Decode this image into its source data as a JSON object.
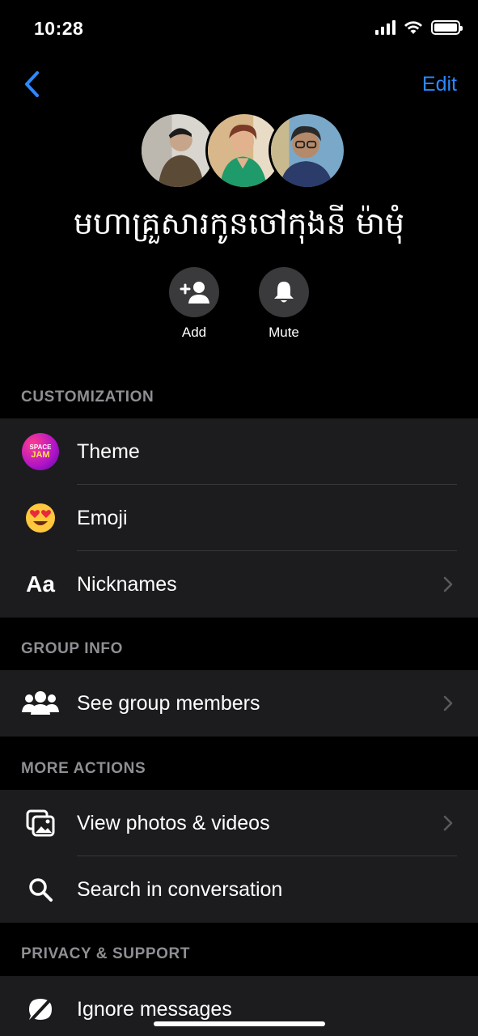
{
  "status_bar": {
    "time": "10:28"
  },
  "header": {
    "edit_label": "Edit"
  },
  "group": {
    "name": "មហាគ្រួសារកូនចៅកុងនី ម៉ាមុំ"
  },
  "actions": [
    {
      "label": "Add",
      "icon": "add-person-icon"
    },
    {
      "label": "Mute",
      "icon": "bell-icon"
    }
  ],
  "sections": {
    "customization": {
      "title": "CUSTOMIZATION",
      "items": [
        {
          "label": "Theme",
          "icon": "theme-icon",
          "icon_text": [
            "SPACE",
            "JAM"
          ]
        },
        {
          "label": "Emoji",
          "icon": "heart-eyes-emoji-icon"
        },
        {
          "label": "Nicknames",
          "icon": "text-aa-icon",
          "icon_text": "Aa"
        }
      ]
    },
    "group_info": {
      "title": "GROUP INFO",
      "items": [
        {
          "label": "See group members",
          "icon": "people-icon"
        }
      ]
    },
    "more_actions": {
      "title": "MORE ACTIONS",
      "items": [
        {
          "label": "View photos & videos",
          "icon": "photos-icon"
        },
        {
          "label": "Search in conversation",
          "icon": "search-icon"
        }
      ]
    },
    "privacy_support": {
      "title": "PRIVACY & SUPPORT",
      "items": [
        {
          "label": "Ignore messages",
          "icon": "ignore-icon"
        }
      ]
    }
  },
  "colors": {
    "accent": "#2d88ff",
    "background": "#000000",
    "group_background": "#1c1c1e",
    "section_header": "#8e8e93"
  }
}
